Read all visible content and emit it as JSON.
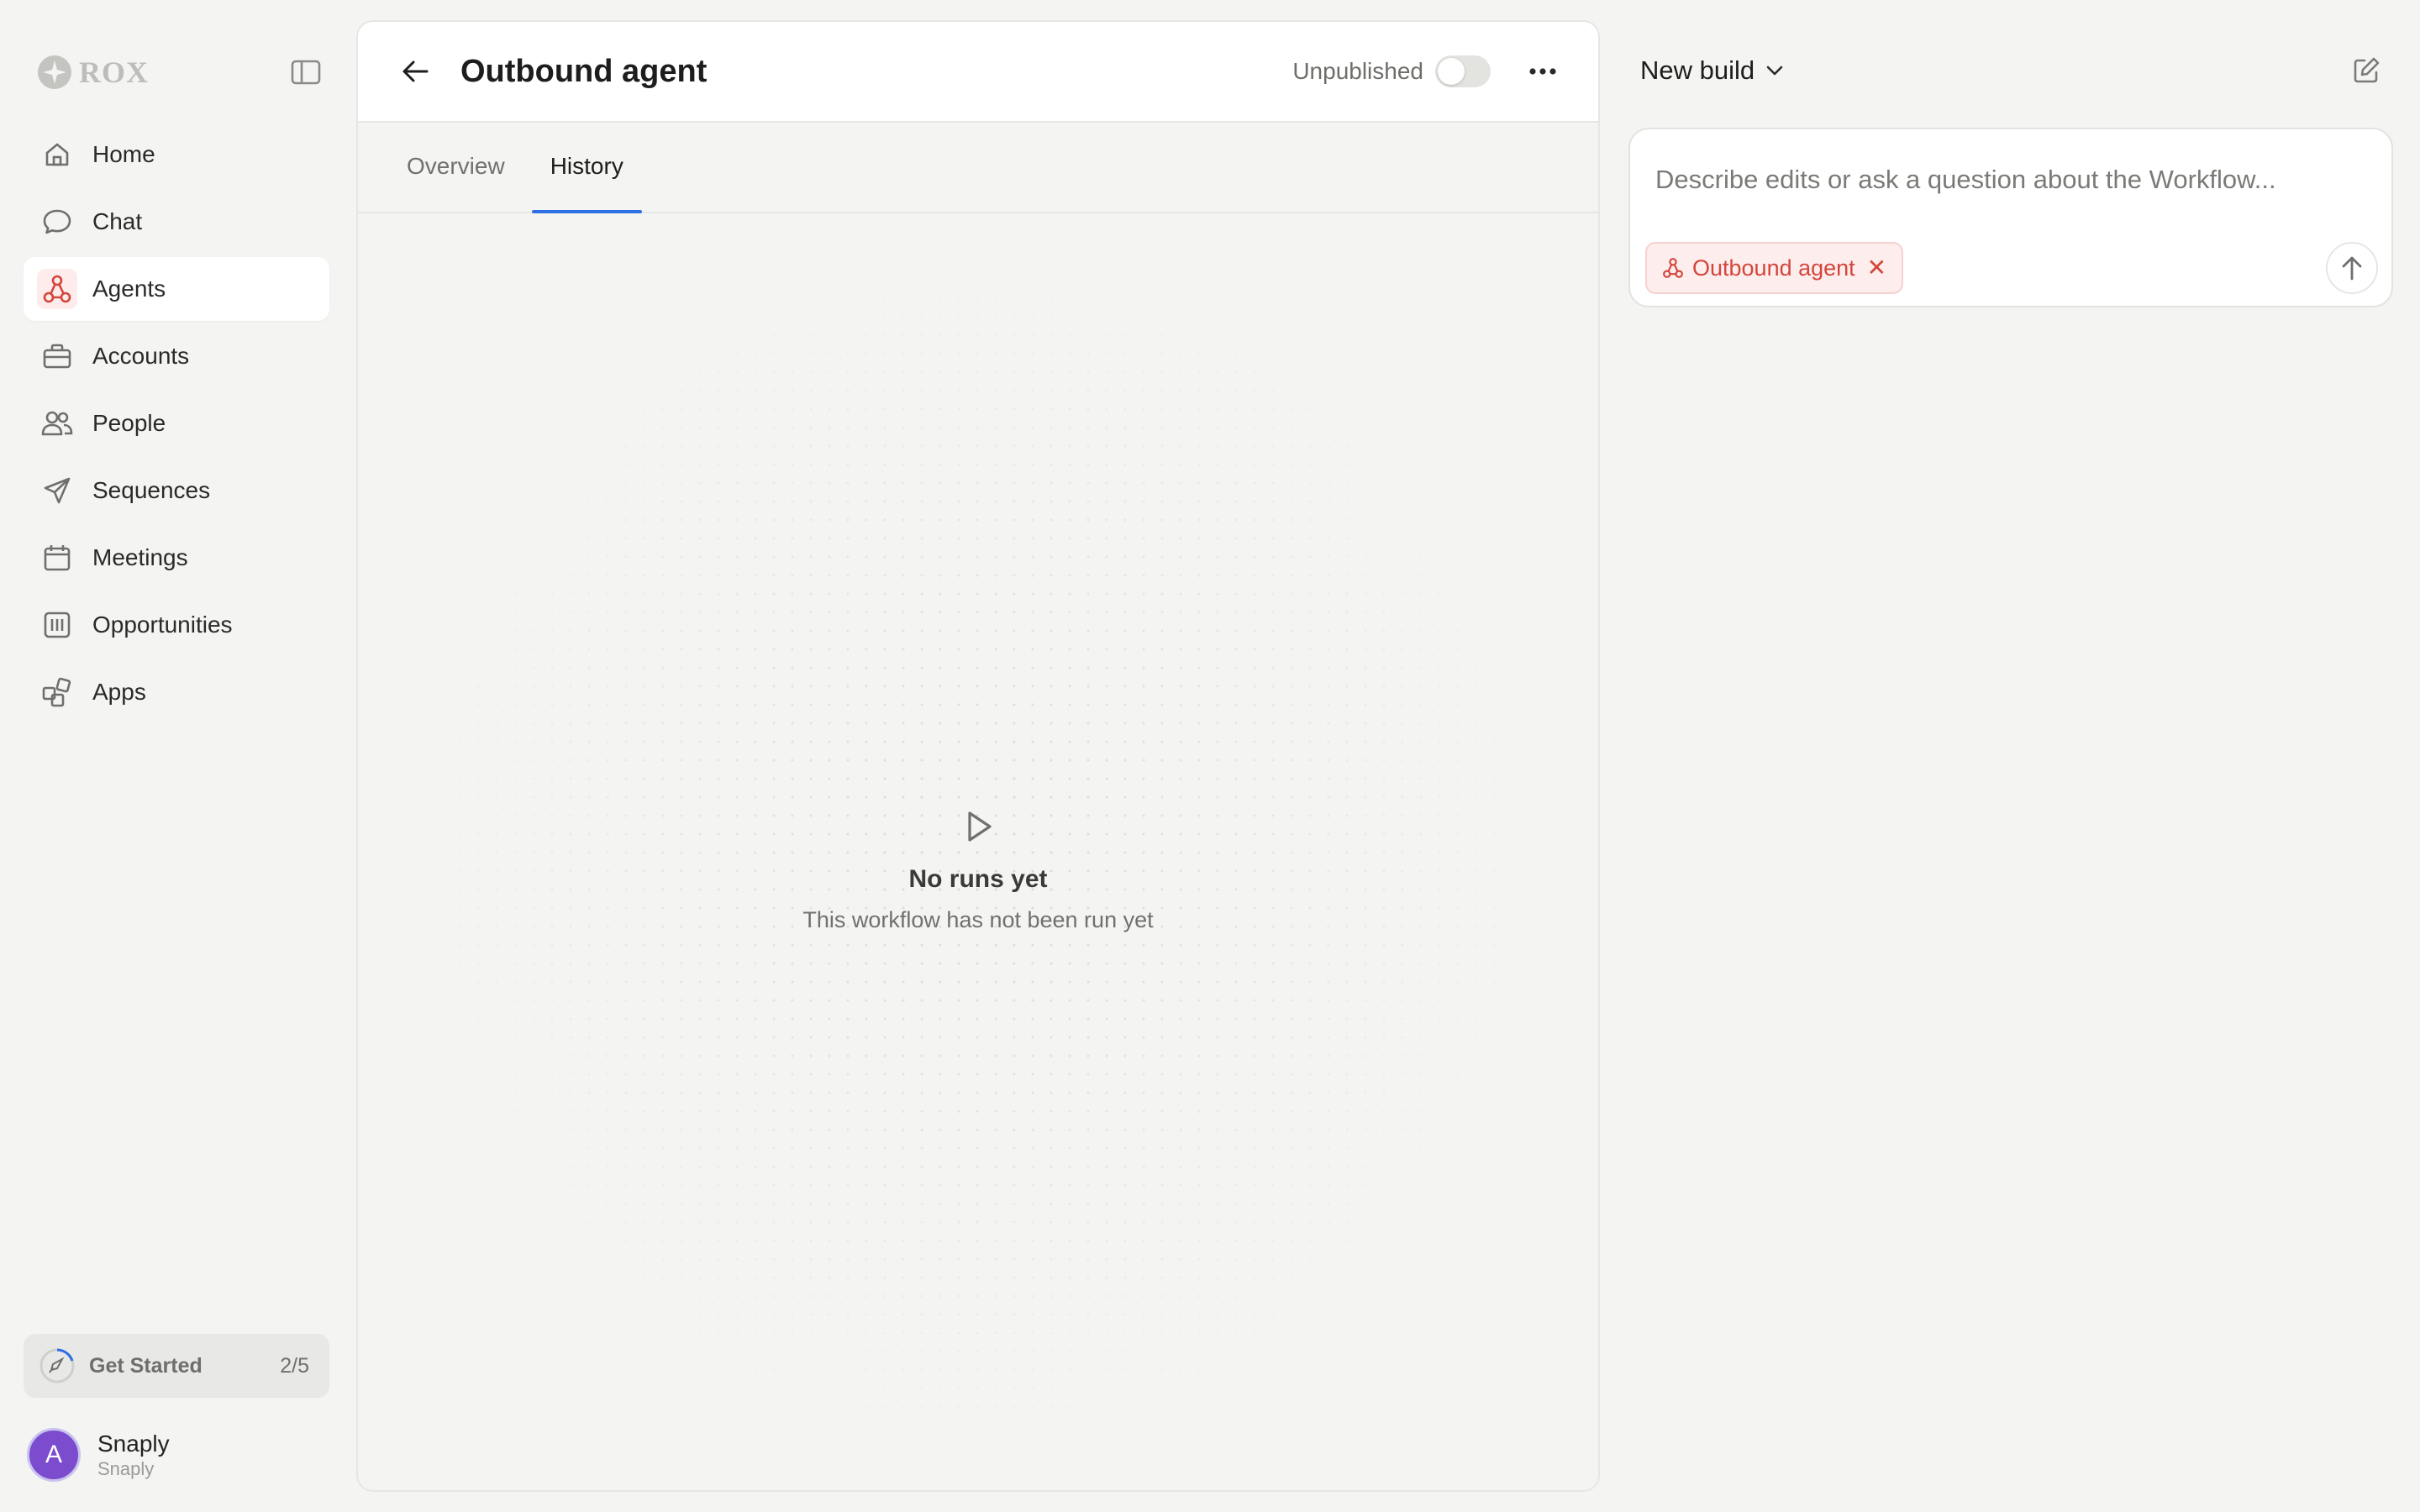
{
  "sidebar": {
    "logo_text": "ROX",
    "items": [
      {
        "label": "Home",
        "icon": "home-icon"
      },
      {
        "label": "Chat",
        "icon": "chat-icon"
      },
      {
        "label": "Agents",
        "icon": "agents-icon",
        "active": true
      },
      {
        "label": "Accounts",
        "icon": "briefcase-icon"
      },
      {
        "label": "People",
        "icon": "people-icon"
      },
      {
        "label": "Sequences",
        "icon": "send-icon"
      },
      {
        "label": "Meetings",
        "icon": "calendar-icon"
      },
      {
        "label": "Opportunities",
        "icon": "columns-icon"
      },
      {
        "label": "Apps",
        "icon": "apps-icon"
      }
    ],
    "get_started": {
      "label": "Get Started",
      "count": "2/5"
    },
    "user": {
      "initial": "A",
      "name": "Snaply",
      "org": "Snaply"
    }
  },
  "main": {
    "title": "Outbound agent",
    "status": "Unpublished",
    "published": false,
    "tabs": [
      {
        "label": "Overview",
        "active": false
      },
      {
        "label": "History",
        "active": true
      }
    ],
    "empty": {
      "title": "No runs yet",
      "subtitle": "This workflow has not been run yet"
    }
  },
  "right": {
    "build_label": "New build",
    "composer": {
      "placeholder": "Describe edits or ask a question about the Workflow...",
      "chip_label": "Outbound agent",
      "chip_close": "✕"
    }
  },
  "colors": {
    "accent_red": "#d4453b",
    "tab_underline": "#2f6fe4",
    "avatar_bg": "#7c4ccf",
    "background": "#f4f4f2"
  }
}
